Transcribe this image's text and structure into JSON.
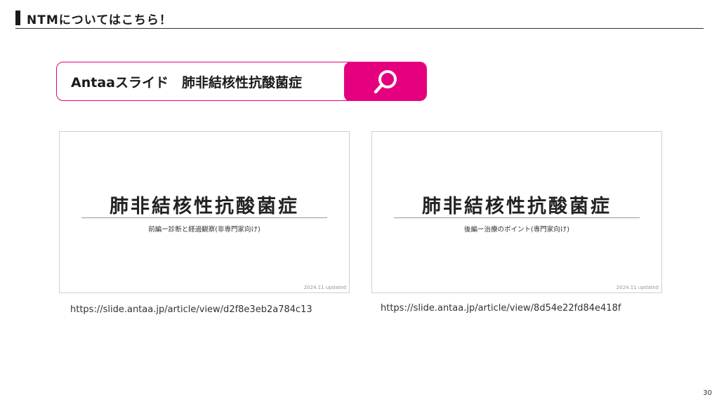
{
  "heading": {
    "text": "NTMについてはこちら！"
  },
  "search": {
    "query": "Antaaスライド　肺非結核性抗酸菌症",
    "icon": "search-icon",
    "accent": "#e4007f"
  },
  "slides": [
    {
      "title": "肺非結核性抗酸菌症",
      "subtitle": "前編ー診断と経過観察(非専門家向け)",
      "date": "2024.11 updated",
      "url": "https://slide.antaa.jp/article/view/d2f8e3eb2a784c13"
    },
    {
      "title": "肺非結核性抗酸菌症",
      "subtitle": "後編ー治療のポイント(専門家向け)",
      "date": "2024.11 updated",
      "url": "https://slide.antaa.jp/article/view/8d54e22fd84e418f"
    }
  ],
  "page_number": "30"
}
